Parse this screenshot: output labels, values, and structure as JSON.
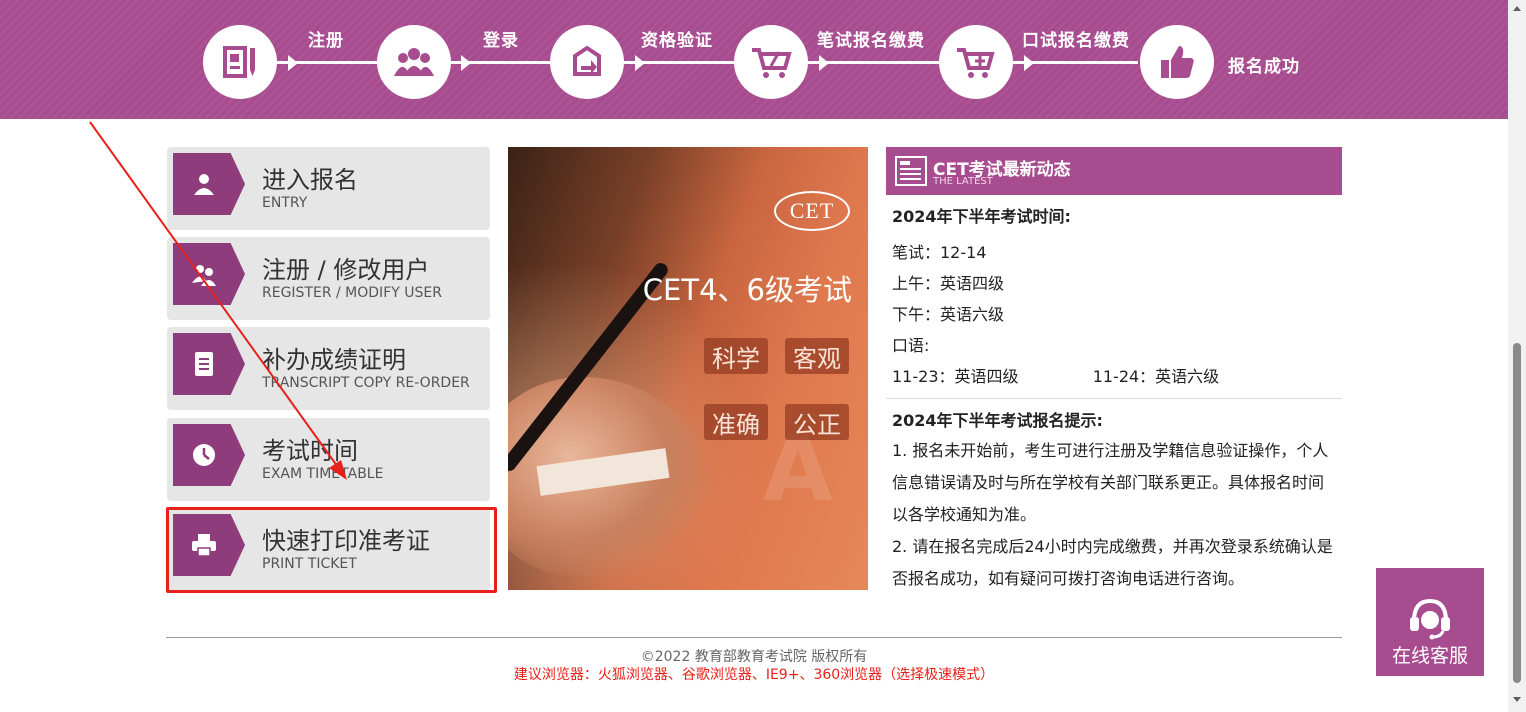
{
  "steps": [
    {
      "label": "注册",
      "icon": "register-form-icon"
    },
    {
      "label": "登录",
      "icon": "users-group-icon"
    },
    {
      "label": "资格验证",
      "icon": "verify-icon"
    },
    {
      "label": "笔试报名缴费",
      "icon": "cart-icon"
    },
    {
      "label": "口试报名缴费",
      "icon": "cart-plus-icon"
    },
    {
      "label": "报名成功",
      "icon": "thumbs-up-icon"
    }
  ],
  "menu": [
    {
      "title": "进入报名",
      "subtitle": "ENTRY",
      "icon": "user-icon"
    },
    {
      "title": "注册 / 修改用户",
      "subtitle": "REGISTER / MODIFY USER",
      "icon": "users-icon"
    },
    {
      "title": "补办成绩证明",
      "subtitle": "TRANSCRIPT COPY RE-ORDER",
      "icon": "document-icon"
    },
    {
      "title": "考试时间",
      "subtitle": "EXAM TIMETABLE",
      "icon": "clock-icon"
    },
    {
      "title": "快速打印准考证",
      "subtitle": "PRINT TICKET",
      "icon": "printer-icon"
    }
  ],
  "promo": {
    "logo": "CET",
    "title": "CET4、6级考试",
    "tags": [
      "科学",
      "客观",
      "准确",
      "公正"
    ]
  },
  "news": {
    "title": "CET考试最新动态",
    "subtitle": "THE LATEST",
    "schedule_title": "2024年下半年考试时间:",
    "written": "笔试：12-14",
    "morning": "上午：英语四级",
    "afternoon": "下午：英语六级",
    "oral_label": "口语:",
    "oral_day1": "11-23：英语四级",
    "oral_day2": "11-24：英语六级",
    "tips_title": "2024年下半年考试报名提示:",
    "tip1": "1. 报名未开始前，考生可进行注册及学籍信息验证操作，个人信息错误请及时与所在学校有关部门联系更正。具体报名时间以各学校通知为准。",
    "tip2": "2. 请在报名完成后24小时内完成缴费，并再次登录系统确认是否报名成功，如有疑问可拨打咨询电话进行咨询。"
  },
  "footer": {
    "copyright": "©2022   教育部教育考试院   版权所有",
    "browsers": "建议浏览器：火狐浏览器、谷歌浏览器、IE9+、360浏览器（选择极速模式）"
  },
  "service": {
    "label": "在线客服",
    "icon": "headset-icon"
  },
  "colors": {
    "brand": "#a84c90",
    "badge": "#8f3c7d",
    "highlight": "#e8201a"
  }
}
